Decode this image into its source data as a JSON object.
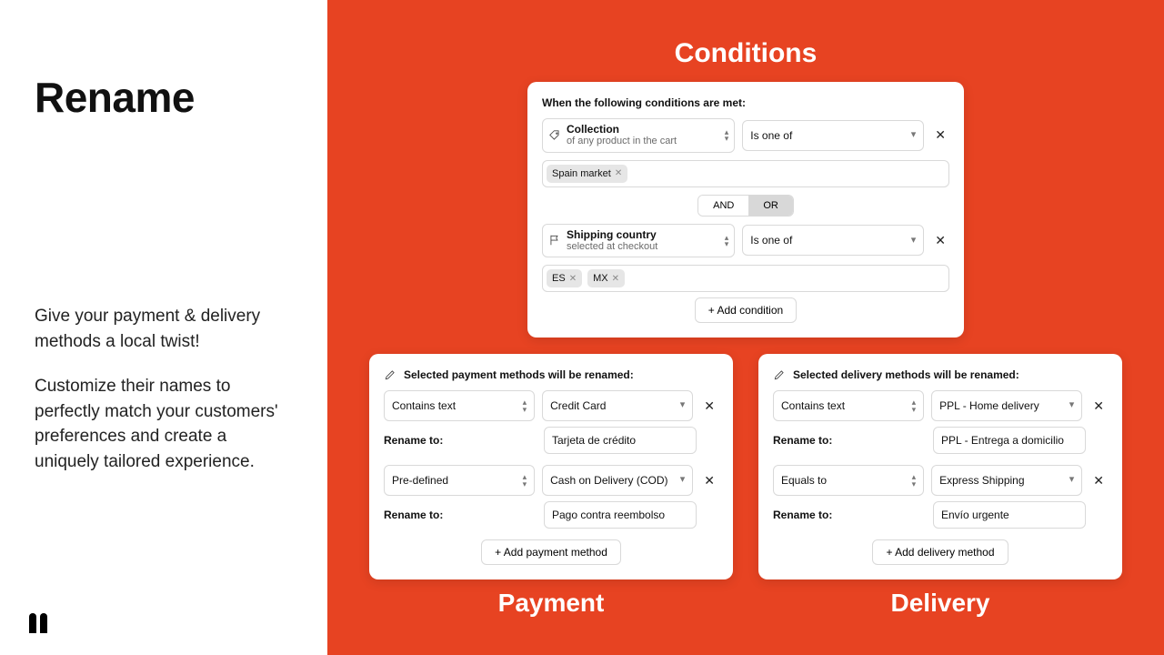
{
  "left": {
    "title": "Rename",
    "para1": "Give your payment & delivery methods a local twist!",
    "para2": "Customize their names to perfectly match your customers' preferences and create a uniquely tailored experience."
  },
  "sections": {
    "conditions": "Conditions",
    "payment": "Payment",
    "delivery": "Delivery"
  },
  "conditions": {
    "header": "When the following conditions are met:",
    "rows": [
      {
        "icon": "tag-icon",
        "title": "Collection",
        "subtitle": "of any product in the cart",
        "operator": "Is one of",
        "tags": [
          "Spain market"
        ]
      },
      {
        "icon": "flag-icon",
        "title": "Shipping country",
        "subtitle": "selected at checkout",
        "operator": "Is one of",
        "tags": [
          "ES",
          "MX"
        ]
      }
    ],
    "and": "AND",
    "or": "OR",
    "add": "+ Add condition"
  },
  "payment": {
    "header": "Selected payment methods will be renamed:",
    "rename_label": "Rename to:",
    "rows": [
      {
        "match": "Contains text",
        "value": "Credit Card",
        "rename": "Tarjeta de crédito"
      },
      {
        "match": "Pre-defined",
        "value": "Cash on Delivery (COD)",
        "rename": "Pago contra reembolso"
      }
    ],
    "add": "+ Add payment method"
  },
  "delivery": {
    "header": "Selected delivery methods will be renamed:",
    "rename_label": "Rename to:",
    "rows": [
      {
        "match": "Contains text",
        "value": "PPL - Home delivery",
        "rename": "PPL - Entrega a domicilio"
      },
      {
        "match": "Equals to",
        "value": "Express Shipping",
        "rename": "Envío urgente"
      }
    ],
    "add": "+ Add delivery method"
  }
}
